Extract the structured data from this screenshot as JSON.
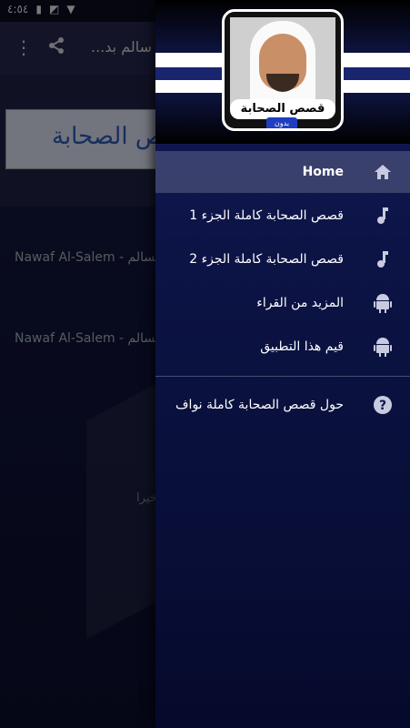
{
  "status_bar": {
    "time": "٤:٥٤",
    "notification_icon": "music-note-icon"
  },
  "background": {
    "toolbar_title": "...سالم بد",
    "banner_text": "قصص الصحابة",
    "list_items": [
      "Nawaf Al-Salem - ف السالم",
      "Nawaf Al-Salem - ف السالم"
    ],
    "note_text": "خيرا"
  },
  "drawer": {
    "cover_title": "قصص الصحابة",
    "cover_badge": "بدون انترنت",
    "menu": [
      {
        "label": "Home",
        "icon": "home-icon",
        "active": true
      },
      {
        "label": "قصص الصحابة كاملة الجزء 1",
        "icon": "music-note-icon",
        "active": false
      },
      {
        "label": "قصص الصحابة كاملة الجزء 2",
        "icon": "music-note-icon",
        "active": false
      },
      {
        "label": "المزيد من القراء",
        "icon": "android-icon",
        "active": false
      },
      {
        "label": "قيم هذا التطبيق",
        "icon": "android-icon",
        "active": false
      }
    ],
    "about": {
      "label": "حول قصص الصحابة كاملة نواف",
      "icon": "help-icon"
    }
  },
  "colors": {
    "drawer_bg": "#0c1446",
    "active_item_bg": "#3a4068",
    "header_bg": "#1a2570"
  }
}
